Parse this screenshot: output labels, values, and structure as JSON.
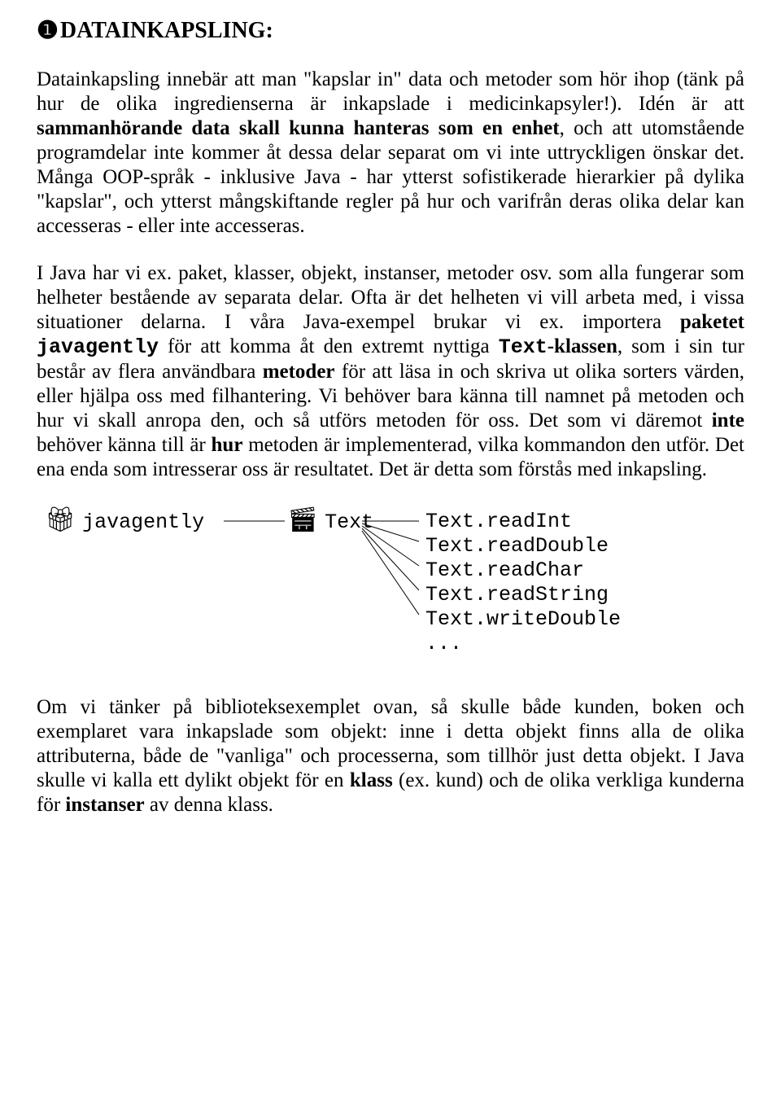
{
  "heading": {
    "bullet": "❶",
    "text": "DATAINKAPSLING:"
  },
  "para1": {
    "t1": "Datainkapsling innebär att man \"kapslar in\" data och metoder som hör ihop (tänk på hur de olika ingredienserna är inkapslade i medicinkapsyler!). Idén är att ",
    "b1": "sammanhörande data skall kunna hanteras som en enhet",
    "t2": ", och att utomstående programdelar inte kommer åt dessa delar separat om vi inte uttryckligen önskar det. Många OOP-språk - inklusive Java - har ytterst sofistikerade hierarkier på dylika \"kapslar\", och ytterst mångskiftande regler på hur och varifrån deras olika delar kan accesseras - eller inte accesseras."
  },
  "para2": {
    "t1": "I Java har vi ex. paket, klasser, objekt, instanser, metoder osv. som alla fungerar som helheter bestående av separata delar. Ofta är det helheten vi vill arbeta med, i vissa situationer delarna. I våra Java-exempel brukar vi ex. importera ",
    "b1": "paketet ",
    "m1": "javagently",
    "t2": " för att komma åt den extremt nyttiga ",
    "m2": "Text",
    "b2": "-klassen",
    "t3": ", som i sin tur består av flera användbara ",
    "b3": "metoder",
    "t4": " för att läsa in och skriva ut olika sorters värden, eller hjälpa oss med filhantering. Vi behöver bara känna till namnet på metoden och hur vi skall anropa den, och så utförs metoden för oss. Det som vi däremot ",
    "b4": "inte",
    "t5": " behöver känna till är ",
    "b5": "hur",
    "t6": " metoden är implementerad, vilka kommandon den utför. Det ena enda som intresserar oss är resultatet. Det är detta som förstås med inkapsling."
  },
  "diagram": {
    "node1": "javagently",
    "node2": "Text",
    "methods": [
      "Text.readInt",
      "Text.readDouble",
      "Text.readChar",
      "Text.readString",
      "Text.writeDouble",
      "..."
    ]
  },
  "para3": {
    "t1": "Om vi tänker på biblioteksexemplet ovan, så skulle både kunden, boken och exemplaret vara inkapslade som objekt: inne i detta objekt finns alla de olika attributerna, både de \"vanliga\" och processerna, som tillhör just detta objekt. I Java skulle vi kalla ett dylikt objekt för en ",
    "b1": "klass",
    "t2": " (ex. kund) och de olika verkliga kunderna för ",
    "b2": "instanser",
    "t3": " av denna klass."
  }
}
